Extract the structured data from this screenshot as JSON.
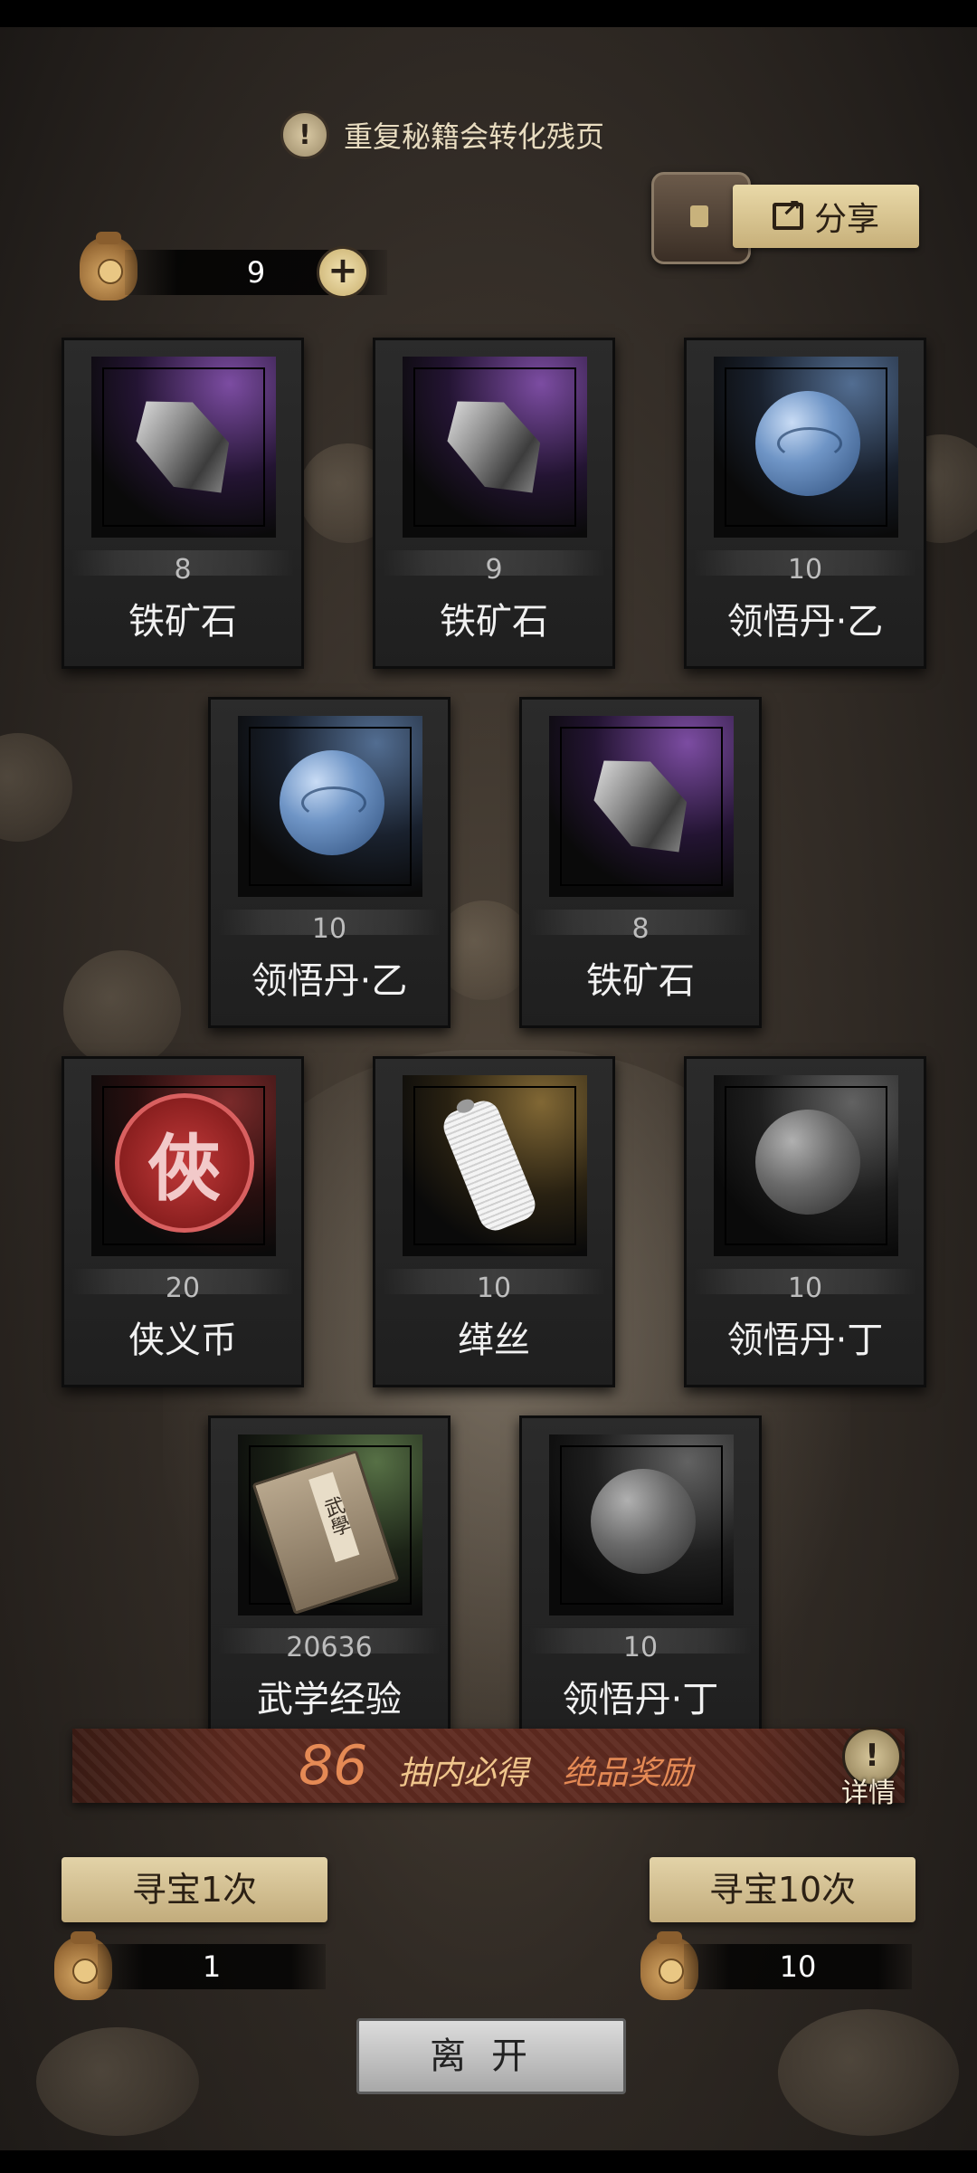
{
  "notice": {
    "text": "重复秘籍会转化残页"
  },
  "share": {
    "label": "分享"
  },
  "currency": {
    "amount": "9",
    "plus": "+"
  },
  "items": [
    {
      "qty": "8",
      "name": "铁矿石",
      "rarity": "purple",
      "icon": "iron-ore-icon"
    },
    {
      "qty": "9",
      "name": "铁矿石",
      "rarity": "purple",
      "icon": "iron-ore-icon"
    },
    {
      "qty": "10",
      "name": "领悟丹·乙",
      "rarity": "blue",
      "icon": "blue-pill-icon"
    },
    {
      "qty": "10",
      "name": "领悟丹·乙",
      "rarity": "blue",
      "icon": "blue-pill-icon"
    },
    {
      "qty": "8",
      "name": "铁矿石",
      "rarity": "purple",
      "icon": "iron-ore-icon"
    },
    {
      "qty": "20",
      "name": "侠义币",
      "rarity": "red",
      "icon": "chivalry-coin-icon",
      "seal_char": "俠"
    },
    {
      "qty": "10",
      "name": "缂丝",
      "rarity": "gold",
      "icon": "silk-spool-icon"
    },
    {
      "qty": "10",
      "name": "领悟丹·丁",
      "rarity": "gray",
      "icon": "gray-pill-icon"
    },
    {
      "qty": "20636",
      "name": "武学经验",
      "rarity": "green",
      "icon": "martial-book-icon"
    },
    {
      "qty": "10",
      "name": "领悟丹·丁",
      "rarity": "gray",
      "icon": "gray-pill-icon"
    }
  ],
  "banner": {
    "count": "86",
    "text1": "抽内必得",
    "text2": "绝品奖励",
    "detail_label": "详情",
    "detail_mark": "!"
  },
  "draw": {
    "single": {
      "label": "寻宝1次",
      "cost": "1"
    },
    "ten": {
      "label": "寻宝10次",
      "cost": "10"
    }
  },
  "leave": {
    "label": "离开"
  },
  "colors": {
    "accent_gold": "#c7b07a",
    "banner_red": "#5e2a1f",
    "count_orange": "#e58a55"
  }
}
